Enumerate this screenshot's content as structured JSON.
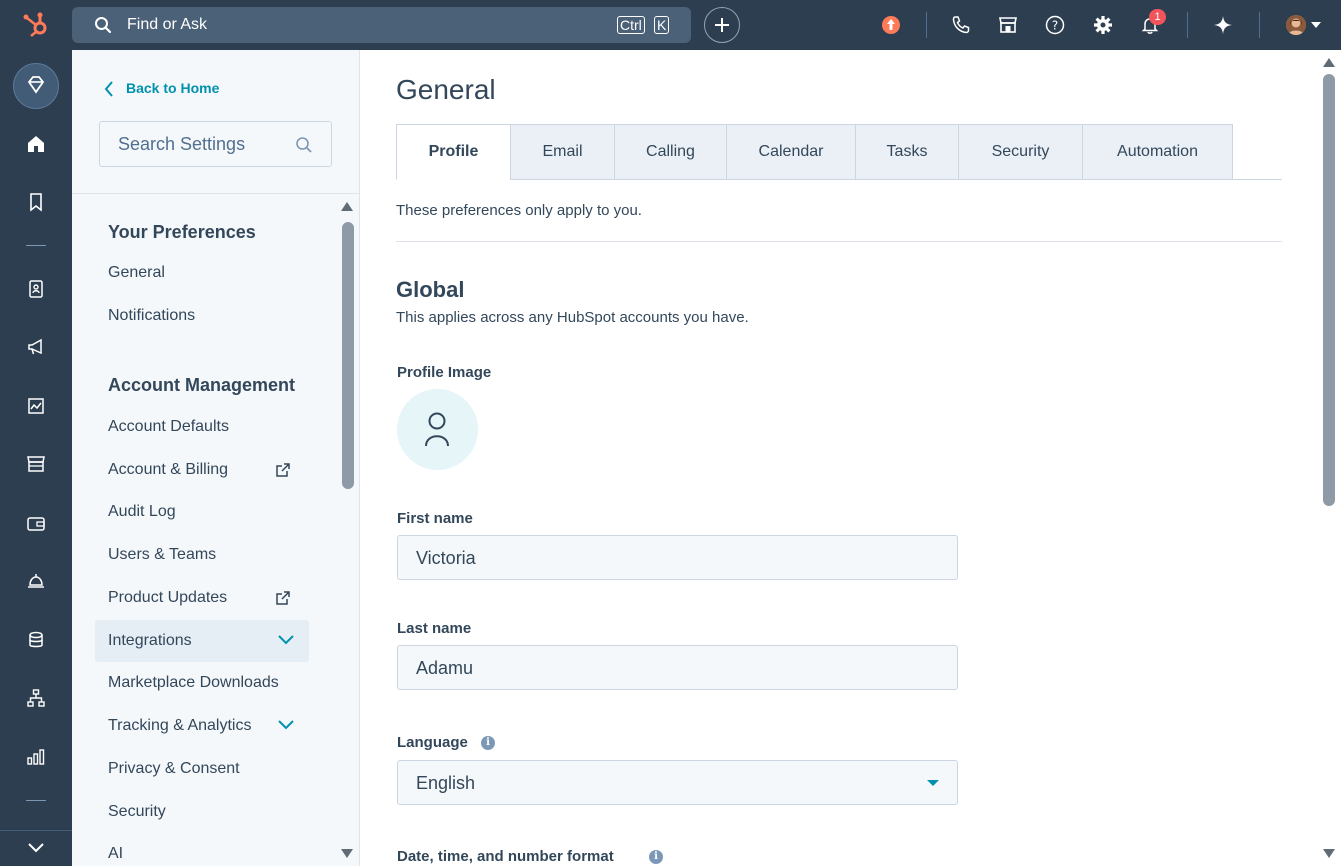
{
  "topbar": {
    "search_placeholder": "Find or Ask",
    "kbd_ctrl": "Ctrl",
    "kbd_k": "K",
    "notification_count": "1",
    "accent_upgrade": "#ff7a59"
  },
  "sidebar": {
    "back_label": "Back to Home",
    "search_placeholder": "Search Settings",
    "sections": [
      {
        "title": "Your Preferences"
      },
      {
        "title": "Account Management"
      }
    ],
    "items": [
      {
        "label": "General"
      },
      {
        "label": "Notifications"
      },
      {
        "label": "Account Defaults"
      },
      {
        "label": "Account & Billing"
      },
      {
        "label": "Audit Log"
      },
      {
        "label": "Users & Teams"
      },
      {
        "label": "Product Updates"
      },
      {
        "label": "Integrations"
      },
      {
        "label": "Marketplace Downloads"
      },
      {
        "label": "Tracking & Analytics"
      },
      {
        "label": "Privacy & Consent"
      },
      {
        "label": "Security"
      },
      {
        "label": "AI"
      }
    ]
  },
  "main": {
    "title": "General",
    "tabs": [
      {
        "label": "Profile"
      },
      {
        "label": "Email"
      },
      {
        "label": "Calling"
      },
      {
        "label": "Calendar"
      },
      {
        "label": "Tasks"
      },
      {
        "label": "Security"
      },
      {
        "label": "Automation"
      }
    ],
    "intro": "These preferences only apply to you.",
    "global_heading": "Global",
    "global_sub": "This applies across any HubSpot accounts you have.",
    "profile_image_label": "Profile Image",
    "first_name_label": "First name",
    "first_name_value": "Victoria",
    "last_name_label": "Last name",
    "last_name_value": "Adamu",
    "language_label": "Language",
    "language_value": "English",
    "date_format_label": "Date, time, and number format"
  }
}
